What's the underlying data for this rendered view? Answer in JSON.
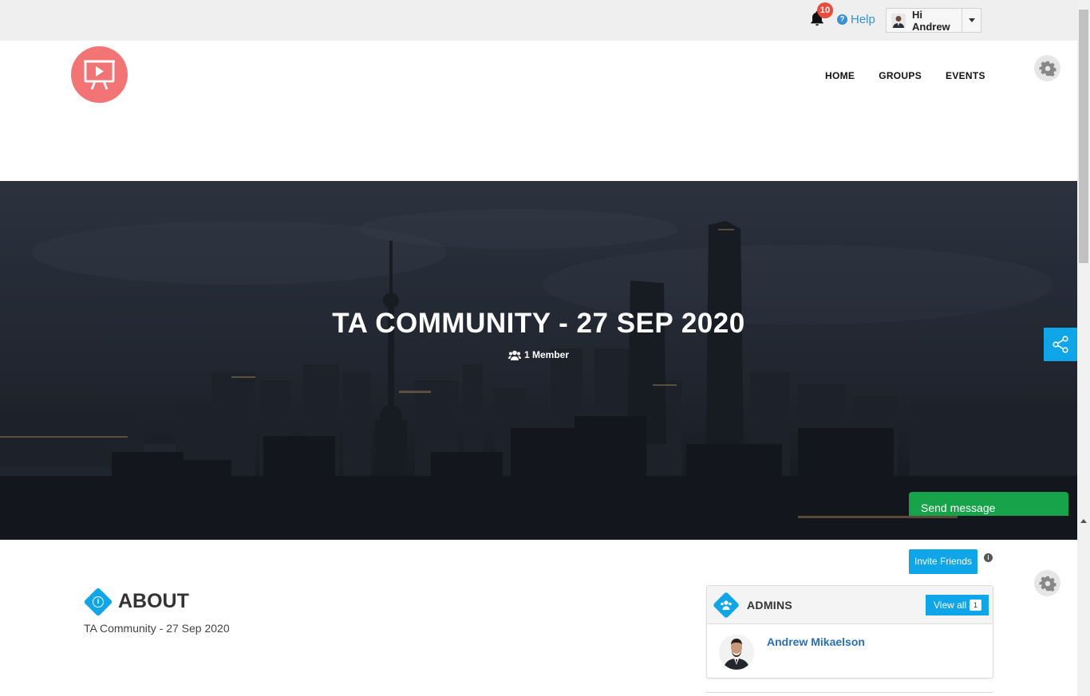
{
  "topbar": {
    "notification_count": "10",
    "help_label": "Help",
    "user_greeting": "Hi Andrew"
  },
  "nav": {
    "items": [
      "HOME",
      "GROUPS",
      "EVENTS"
    ]
  },
  "hero": {
    "title": "TA COMMUNITY - 27 SEP 2020",
    "members": "1 Member",
    "send_message": "Send message"
  },
  "actions": {
    "invite_friends": "Invite Friends"
  },
  "about": {
    "title": "ABOUT",
    "text": "TA Community - 27 Sep 2020"
  },
  "admins": {
    "title": "ADMINS",
    "view_all_label": "View all",
    "view_all_count": "1",
    "list": [
      {
        "name": "Andrew Mikaelson"
      }
    ]
  },
  "colors": {
    "accent": "#0ea5e9",
    "logo": "#f37474",
    "send_message": "#16a34a",
    "badge": "#e74c3c",
    "link": "#2a6fb5"
  },
  "icons": [
    "bell-icon",
    "help-icon",
    "caret-down-icon",
    "presentation-icon",
    "gear-icon",
    "users-icon",
    "share-icon",
    "info-icon"
  ]
}
